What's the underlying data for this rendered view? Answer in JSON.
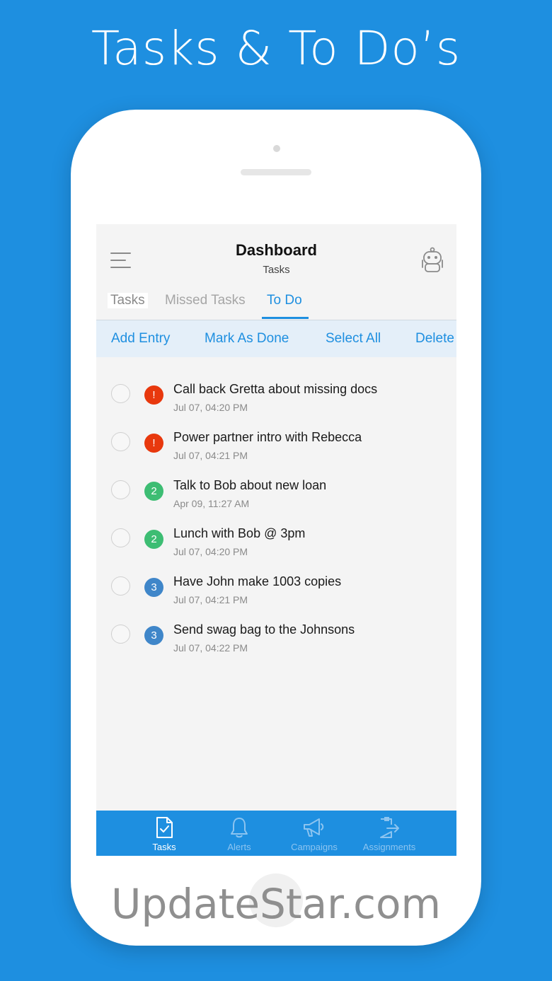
{
  "headline": "Tasks & To Do’s",
  "header": {
    "title": "Dashboard",
    "subtitle": "Tasks"
  },
  "tabs": [
    {
      "label": "Tasks"
    },
    {
      "label": "Missed Tasks"
    },
    {
      "label": "To Do",
      "active": true
    }
  ],
  "actions": {
    "add": "Add Entry",
    "mark": "Mark As Done",
    "select": "Select All",
    "delete": "Delete"
  },
  "todos": [
    {
      "badge": "!",
      "badge_color": "#e8380d",
      "title": "Call back Gretta about missing docs",
      "time": "Jul 07, 04:20 PM"
    },
    {
      "badge": "!",
      "badge_color": "#e8380d",
      "title": "Power partner intro with Rebecca",
      "time": "Jul 07, 04:21 PM"
    },
    {
      "badge": "2",
      "badge_color": "#3dbd73",
      "title": "Talk to Bob about new loan",
      "time": "Apr 09, 11:27 AM"
    },
    {
      "badge": "2",
      "badge_color": "#3dbd73",
      "title": "Lunch with Bob @ 3pm",
      "time": "Jul 07, 04:20 PM"
    },
    {
      "badge": "3",
      "badge_color": "#3f86c9",
      "title": "Have John make 1003 copies",
      "time": "Jul 07, 04:21 PM"
    },
    {
      "badge": "3",
      "badge_color": "#3f86c9",
      "title": "Send swag bag to the Johnsons",
      "time": "Jul 07, 04:22 PM"
    }
  ],
  "tabbar": [
    {
      "label": "Tasks",
      "icon": "task-document-icon",
      "active": true
    },
    {
      "label": "Alerts",
      "icon": "bell-icon"
    },
    {
      "label": "Campaigns",
      "icon": "megaphone-icon"
    },
    {
      "label": "Assignments",
      "icon": "assignment-export-icon"
    }
  ],
  "watermark": "UpdateStar.com",
  "colors": {
    "background": "#1e8fe0",
    "accent": "#1e8fe0",
    "priority_high": "#e8380d",
    "priority_medium": "#3dbd73",
    "priority_low": "#3f86c9"
  }
}
